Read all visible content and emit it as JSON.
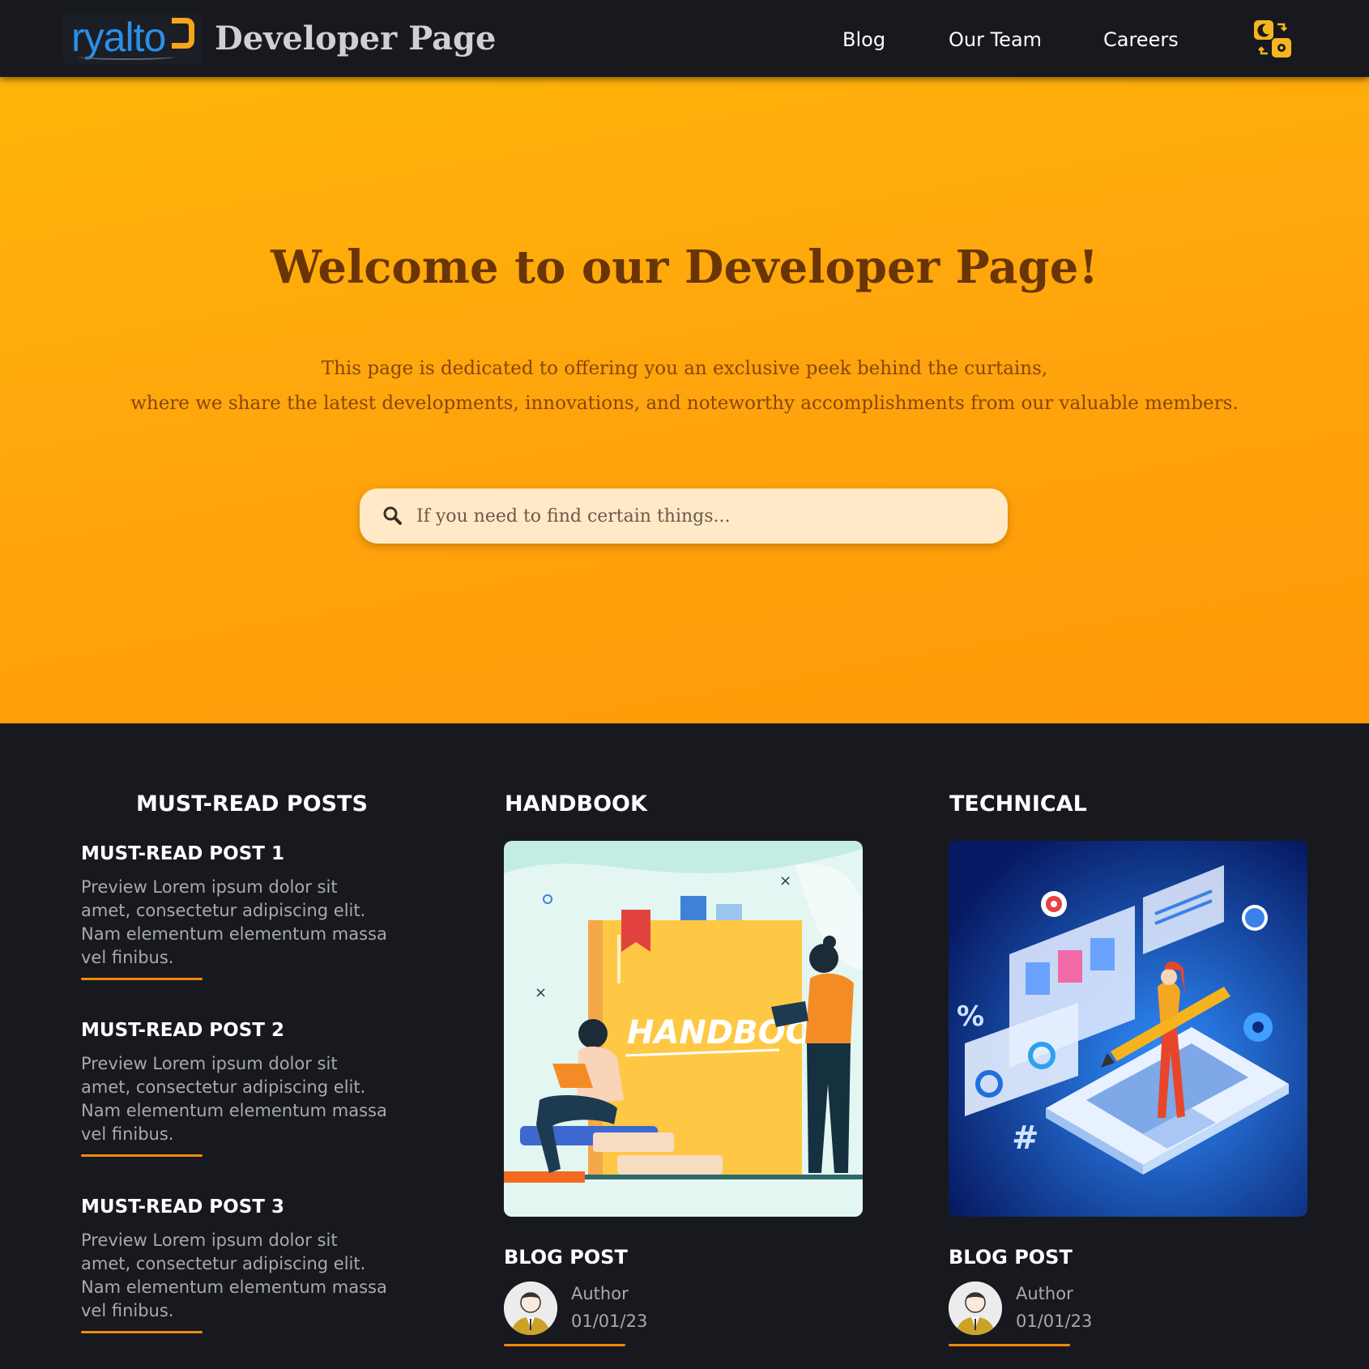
{
  "header": {
    "logo_text": "ryalto",
    "site_title": "Developer Page",
    "nav": [
      {
        "label": "Blog"
      },
      {
        "label": "Our Team"
      },
      {
        "label": "Careers"
      }
    ],
    "theme_toggle_icon": "theme-toggle-icon"
  },
  "hero": {
    "title": "Welcome to our Developer Page!",
    "subtitle_line1": "This page is dedicated to offering you an exclusive peek behind the curtains,",
    "subtitle_line2": "where we share the latest developments, innovations, and noteworthy accomplishments from our valuable members.",
    "search": {
      "placeholder": "If you need to find certain things...",
      "value": "",
      "icon": "search-icon"
    }
  },
  "must_read": {
    "title": "MUST-READ POSTS",
    "posts": [
      {
        "title": "MUST-READ POST 1",
        "preview": "Preview Lorem ipsum dolor sit amet, consectetur adipiscing elit. Nam elementum elementum massa vel finibus."
      },
      {
        "title": "MUST-READ POST 2",
        "preview": "Preview Lorem ipsum dolor sit amet, consectetur adipiscing elit. Nam elementum elementum massa vel finibus."
      },
      {
        "title": "MUST-READ POST 3",
        "preview": "Preview Lorem ipsum dolor sit amet, consectetur adipiscing elit. Nam elementum elementum massa vel finibus."
      }
    ]
  },
  "handbook": {
    "title": "HANDBOOK",
    "image_text": "HANDBOOK",
    "post_label": "BLOG POST",
    "author": "Author",
    "date": "01/01/23"
  },
  "technical": {
    "title": "TECHNICAL",
    "post_label": "BLOG POST",
    "author": "Author",
    "date": "01/01/23"
  },
  "colors": {
    "accent": "#f08a10",
    "header_bg": "#18191e",
    "hero_bg": "#ffa40c",
    "logo_blue": "#2b8fe8"
  }
}
